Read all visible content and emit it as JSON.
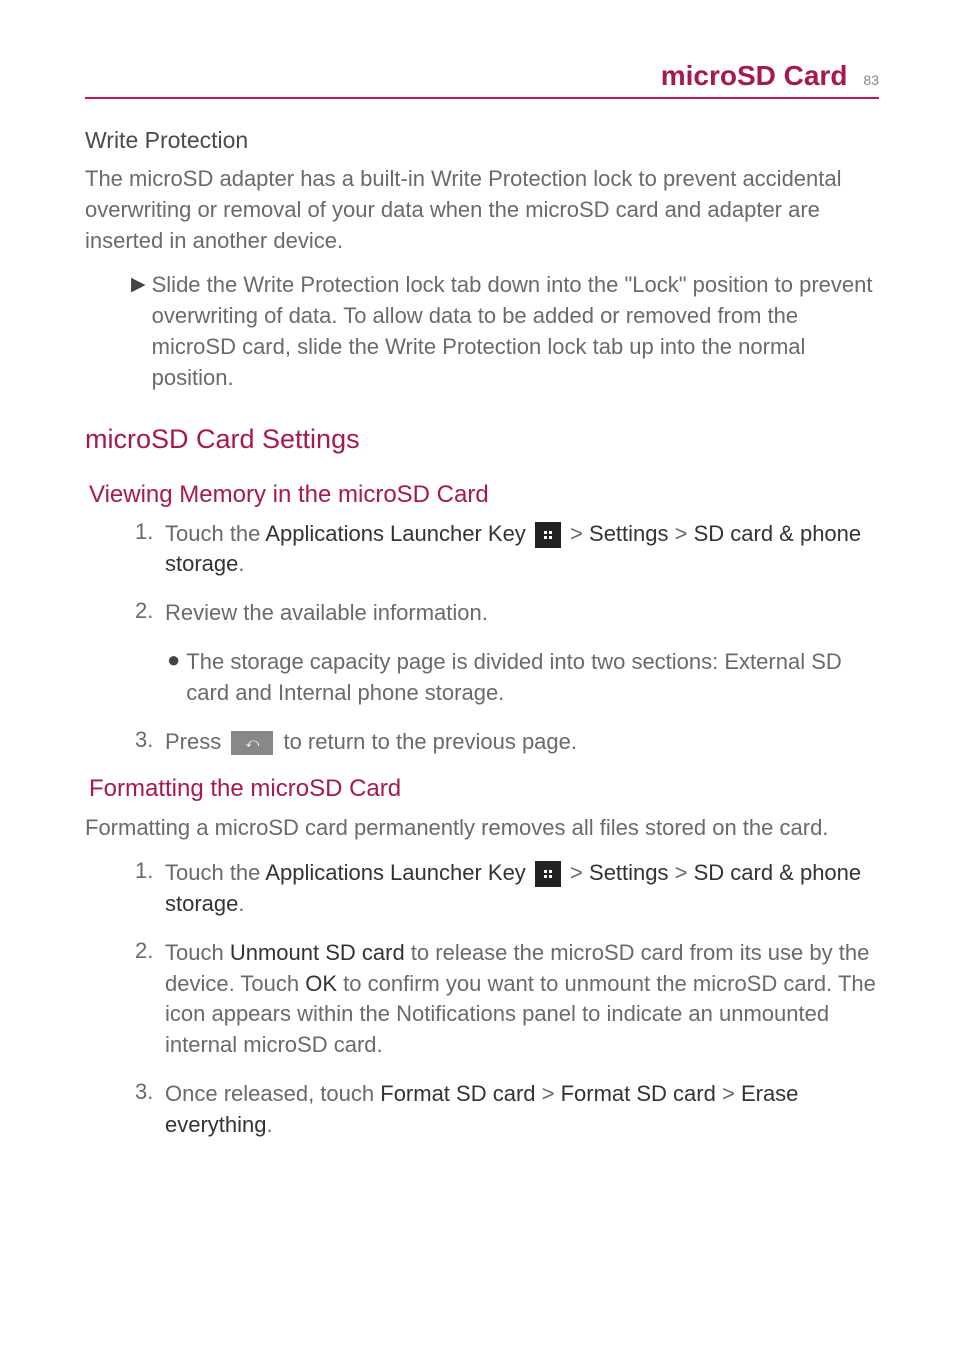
{
  "header": {
    "title": "microSD Card",
    "page": "83"
  },
  "write_protection": {
    "heading": "Write Protection",
    "body": "The microSD adapter has a built-in Write Protection lock to prevent accidental overwriting or removal of your data when the microSD card and adapter are inserted in another device.",
    "bullet": "Slide the Write Protection lock tab down into the \"Lock\" position to prevent overwriting of data. To allow data to be added or removed from the microSD card, slide the Write Protection lock tab up into the normal position."
  },
  "section_title": "microSD Card Settings",
  "viewing": {
    "title": "Viewing Memory in the microSD Card",
    "step1_prefix": "Touch the ",
    "step1_bold1": "Applications Launcher Key",
    "step1_mid": " > ",
    "step1_bold2": "Settings",
    "step1_mid2": " > ",
    "step1_bold3": "SD card & phone storage",
    "step1_end": ".",
    "step2": "Review the available information.",
    "sub_bullet": "The storage capacity page is divided into two sections: External SD card and Internal phone storage.",
    "step3_prefix": "Press ",
    "step3_suffix": " to return to the previous page."
  },
  "formatting": {
    "title": "Formatting the microSD Card",
    "body": "Formatting a microSD card permanently removes all files stored on the card.",
    "step1_prefix": "Touch the ",
    "step1_bold1": "Applications Launcher Key",
    "step1_mid": " > ",
    "step1_bold2": "Settings",
    "step1_mid2": " > ",
    "step1_bold3": "SD card & phone storage",
    "step1_end": ".",
    "step2_prefix": "Touch ",
    "step2_bold1": "Unmount SD card",
    "step2_mid1": " to release the microSD card from its use by the device. Touch ",
    "step2_bold2": "OK",
    "step2_mid2": " to confirm you want to unmount the microSD card. The icon appears within the Notifications panel to indicate an unmounted internal microSD card.",
    "step3_prefix": "Once released, touch ",
    "step3_bold1": "Format SD card",
    "step3_mid1": " > ",
    "step3_bold2": "Format SD card",
    "step3_mid2": " > ",
    "step3_bold3": "Erase everything",
    "step3_end": "."
  }
}
